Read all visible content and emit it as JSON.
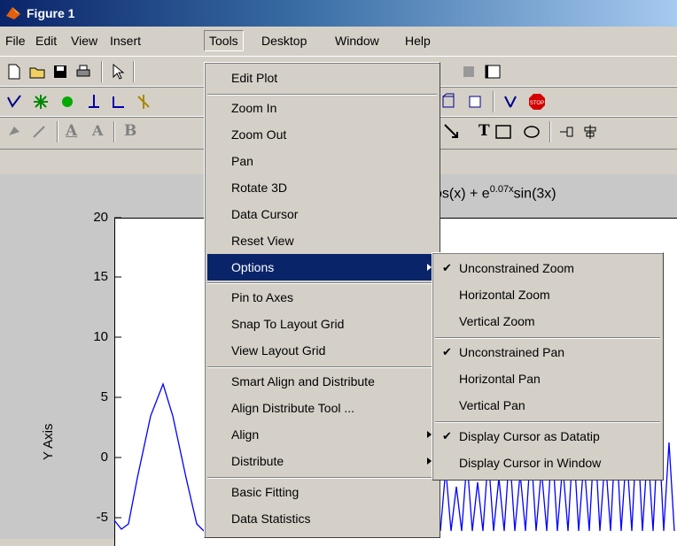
{
  "window": {
    "title": "Figure 1"
  },
  "menubar": [
    "File",
    "Edit",
    "View",
    "Insert",
    "Tools",
    "Desktop",
    "Window",
    "Help"
  ],
  "toolbar_text": {
    "underline_A": "A",
    "plain_A": "A",
    "bold_B": "B",
    "text_T": "T"
  },
  "plot": {
    "title": "os(x) + e",
    "title_exp": "0.07x",
    "title_tail": "sin(3x)",
    "ylabel": "Y Axis",
    "yticks": [
      "20",
      "15",
      "10",
      "5",
      "0",
      "-5"
    ]
  },
  "tools_menu": {
    "items": [
      "Edit Plot",
      "Zoom In",
      "Zoom Out",
      "Pan",
      "Rotate 3D",
      "Data Cursor",
      "Reset View",
      "Options",
      "Pin to Axes",
      "Snap To Layout Grid",
      "View Layout Grid",
      "Smart Align and Distribute",
      "Align Distribute Tool ...",
      "Align",
      "Distribute",
      "Basic Fitting",
      "Data Statistics"
    ]
  },
  "options_menu": {
    "items": [
      {
        "label": "Unconstrained Zoom",
        "checked": true
      },
      {
        "label": "Horizontal Zoom",
        "checked": false
      },
      {
        "label": "Vertical Zoom",
        "checked": false
      },
      {
        "label": "Unconstrained Pan",
        "checked": true
      },
      {
        "label": "Horizontal Pan",
        "checked": false
      },
      {
        "label": "Vertical Pan",
        "checked": false
      },
      {
        "label": "Display Cursor as Datatip",
        "checked": true
      },
      {
        "label": "Display Cursor in Window",
        "checked": false
      }
    ]
  },
  "colors": {
    "highlight": "#0a246a",
    "plot_line": "#0000ff",
    "stop": "#d40000"
  }
}
